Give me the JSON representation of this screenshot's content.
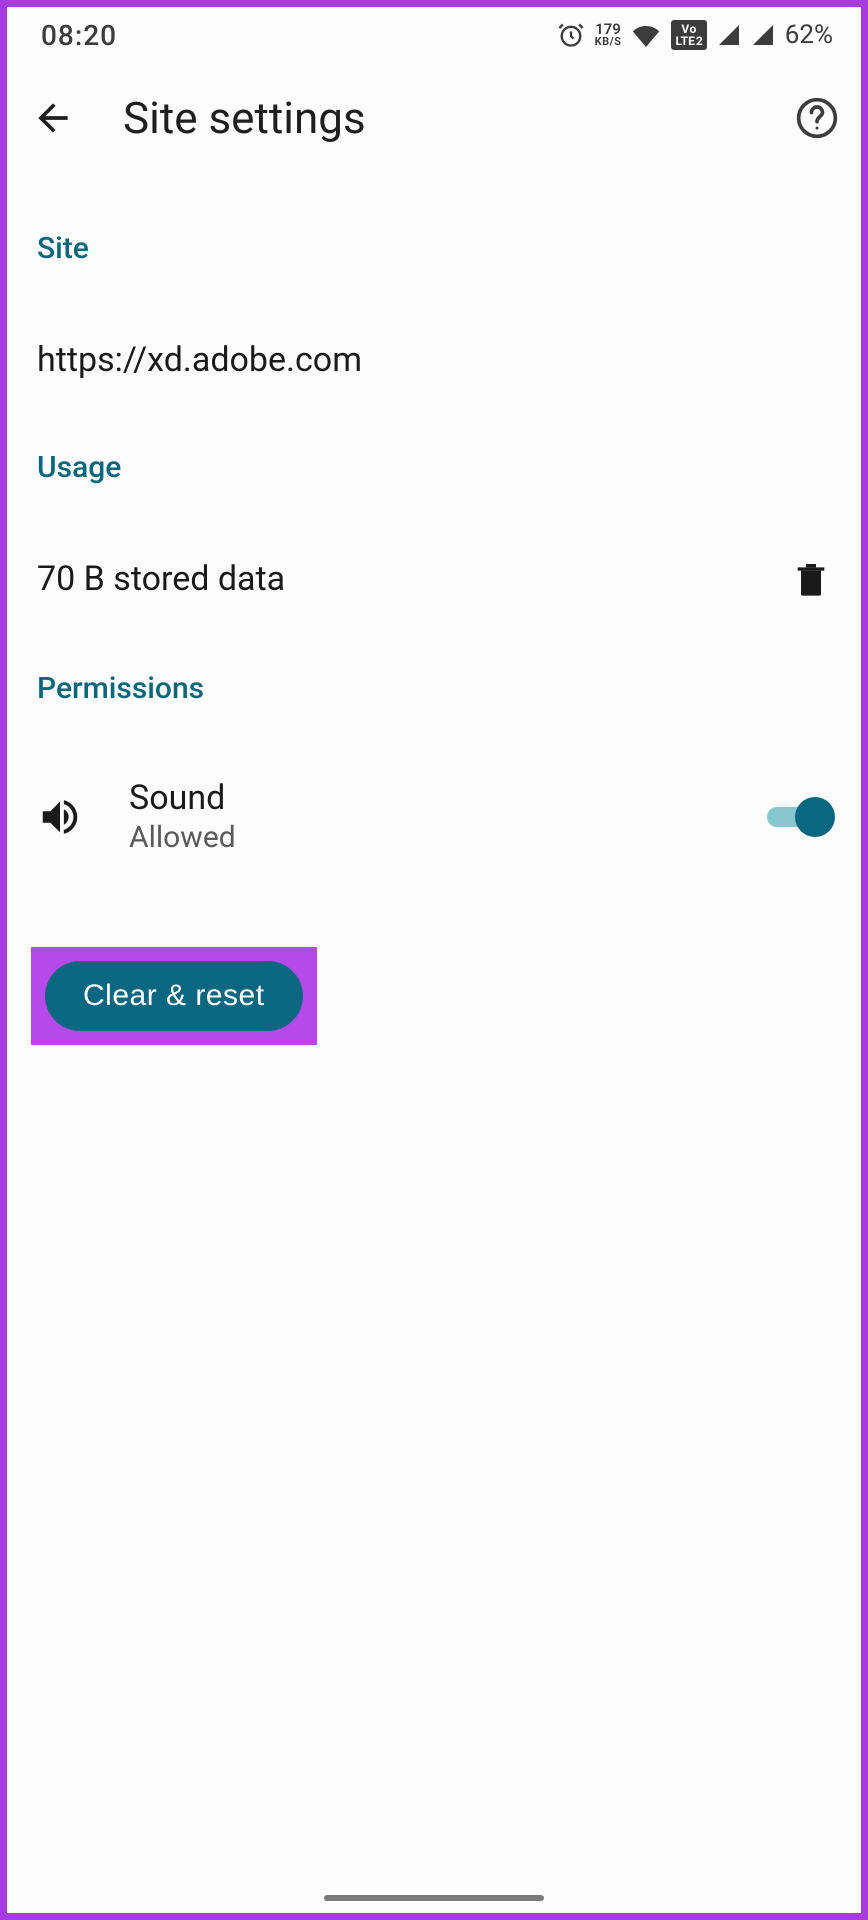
{
  "status_bar": {
    "time": "08:20",
    "speed_top": "179",
    "speed_bot": "KB/S",
    "volte_line1": "Vo",
    "volte_line2a": "LTE",
    "volte_line2b": "2",
    "battery": "62%"
  },
  "app_bar": {
    "title": "Site settings"
  },
  "sections": {
    "site": {
      "header": "Site",
      "url": "https://xd.adobe.com"
    },
    "usage": {
      "header": "Usage",
      "text": "70 B stored data"
    },
    "permissions": {
      "header": "Permissions",
      "sound_title": "Sound",
      "sound_status": "Allowed"
    }
  },
  "clear_reset": "Clear & reset",
  "colors": {
    "highlight": "#B64AE8",
    "teal": "#0b6781",
    "header_teal": "#08677c"
  }
}
